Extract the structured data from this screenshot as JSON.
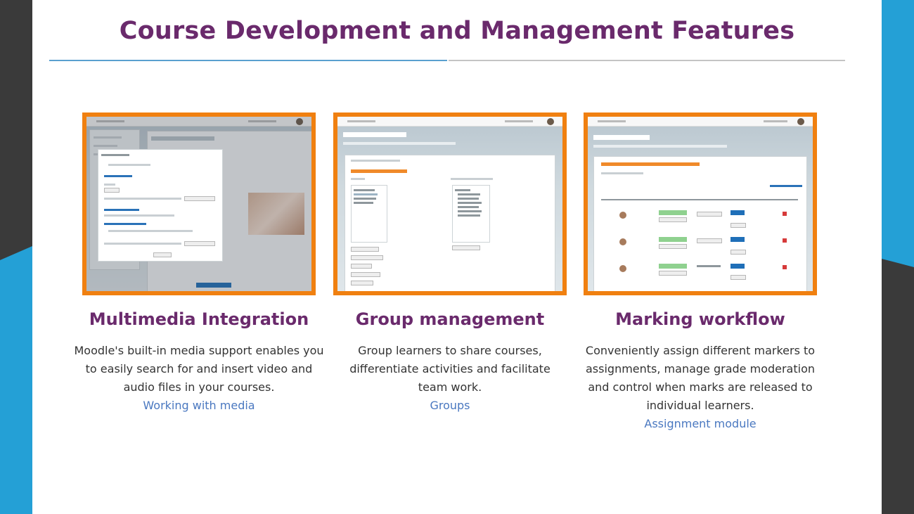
{
  "slide": {
    "title": "Course Development and Management Features"
  },
  "colors": {
    "title": "#6a2a6c",
    "accent_orange": "#f08010",
    "link": "#4a78c0",
    "side_dark": "#3a3a3a",
    "side_blue": "#24a0d6"
  },
  "cards": [
    {
      "title": "Multimedia Integration",
      "description": "Moodle's built-in media support enables you to easily search for and insert video and audio files in your courses.",
      "link": "Working with media"
    },
    {
      "title": "Group management",
      "description": "Group learners to share courses, differentiate activities and facilitate team work.",
      "link": "Groups"
    },
    {
      "title": "Marking workflow",
      "description": "Conveniently assign different markers to assignments, manage grade moderation and control when marks are released to individual learners.",
      "link": "Assignment module"
    }
  ]
}
